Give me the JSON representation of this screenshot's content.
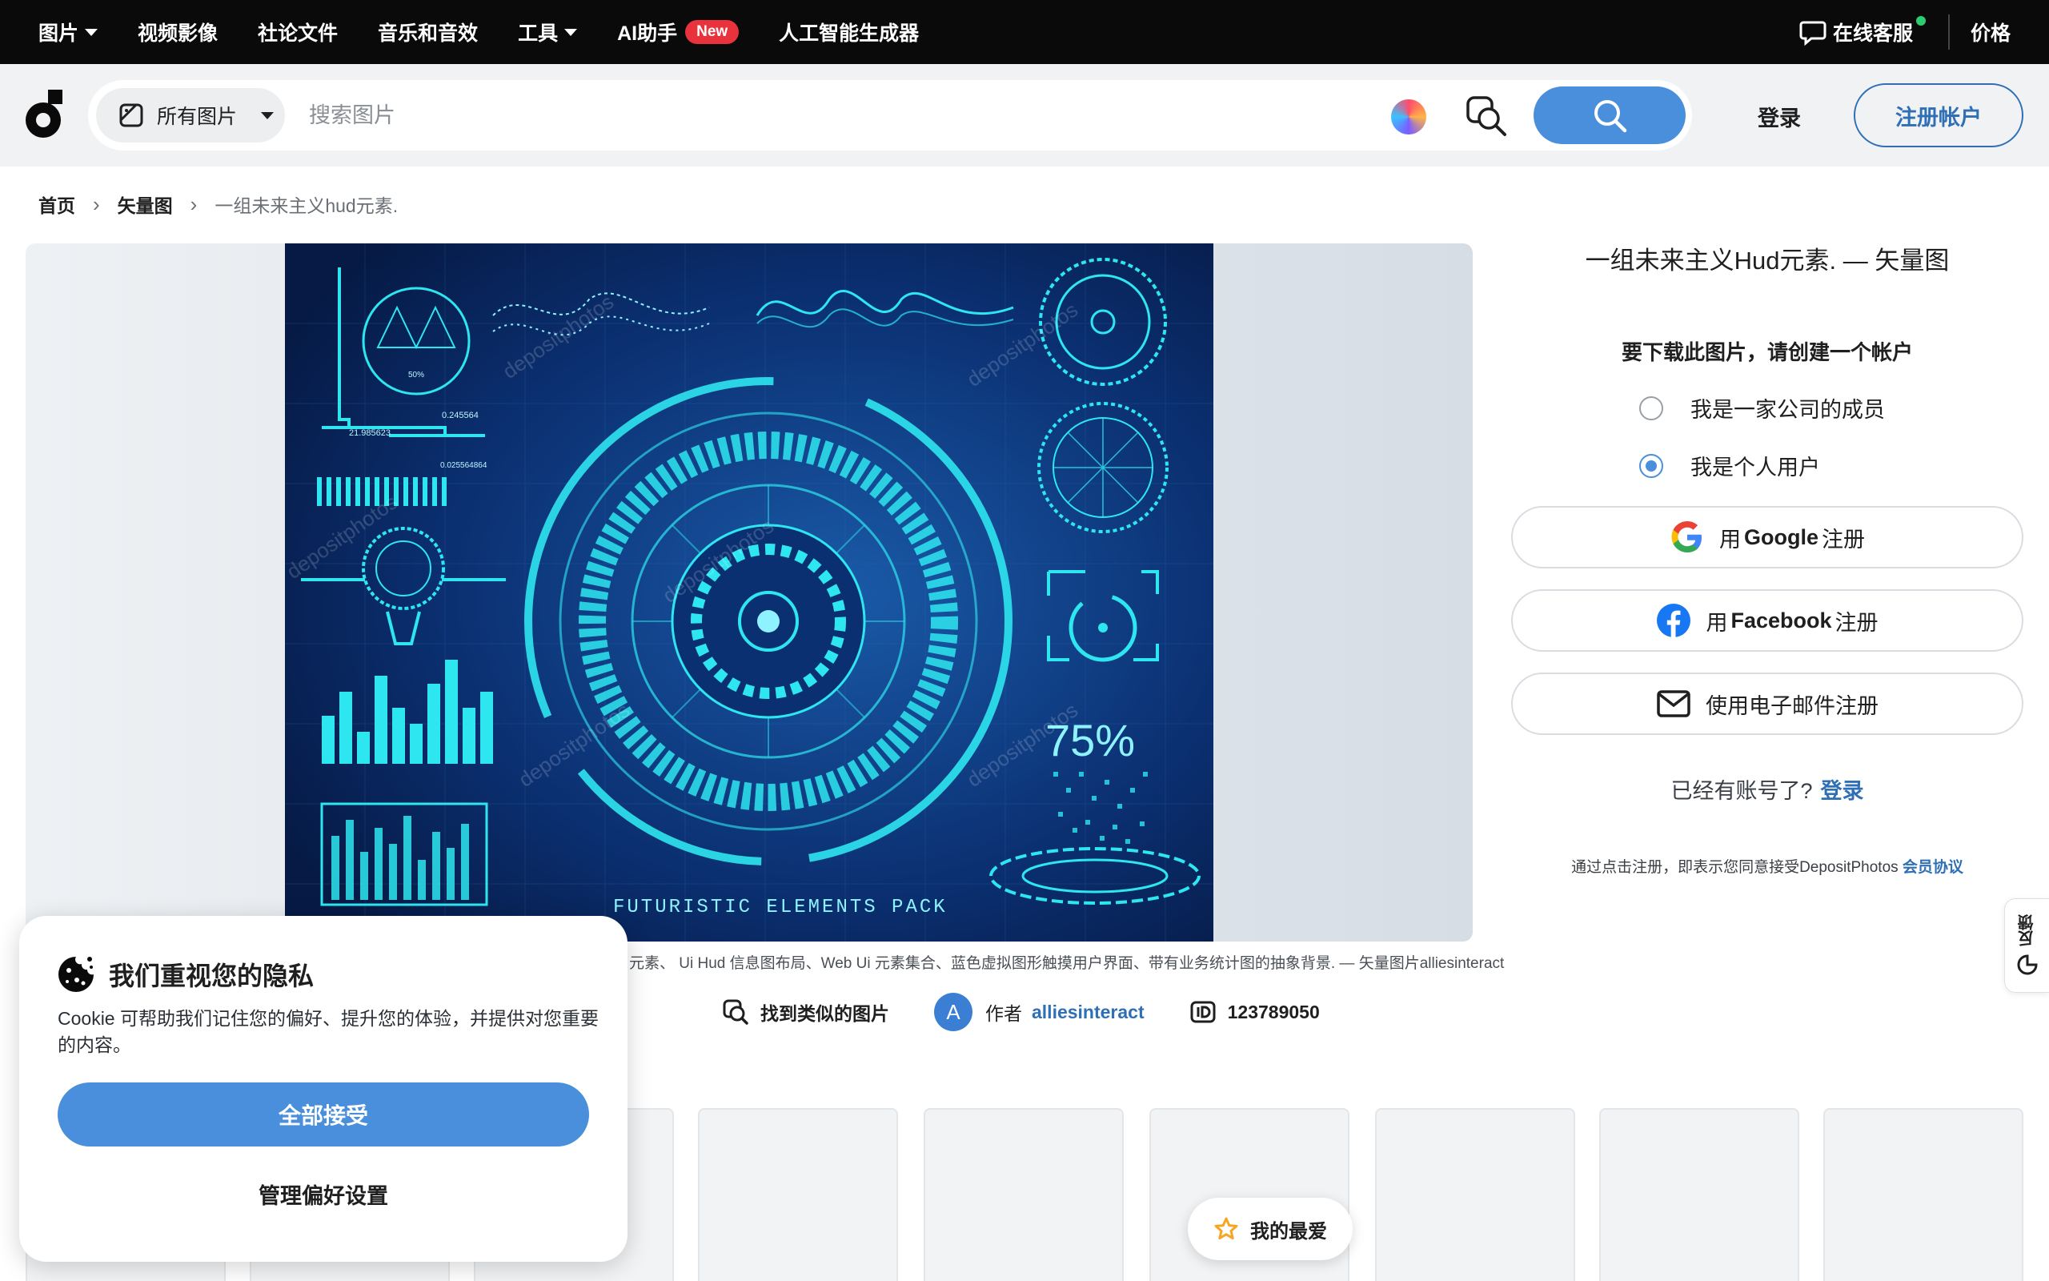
{
  "topnav": {
    "items": [
      {
        "label": "图片",
        "dropdown": true
      },
      {
        "label": "视频影像",
        "dropdown": false
      },
      {
        "label": "社论文件",
        "dropdown": false
      },
      {
        "label": "音乐和音效",
        "dropdown": false
      },
      {
        "label": "工具",
        "dropdown": true
      },
      {
        "label": "AI助手",
        "badge": "New"
      },
      {
        "label": "人工智能生成器",
        "dropdown": false
      }
    ],
    "support_label": "在线客服",
    "pricing_label": "价格"
  },
  "header": {
    "category_label": "所有图片",
    "search_placeholder": "搜索图片",
    "login_label": "登录",
    "signup_label": "注册帐户"
  },
  "breadcrumb": {
    "home": "首页",
    "section": "矢量图",
    "current": "一组未来主义hud元素."
  },
  "preview": {
    "hud_percent_label": "75%",
    "hud_pack_label": "FUTURISTIC ELEMENTS PACK",
    "watermark": "depositphotos",
    "readout_1": "0.245564",
    "readout_2": "21.985623",
    "readout_3": "0.025564864",
    "readout_4": "50%"
  },
  "details": {
    "caption": "元素、 Ui Hud 信息图布局、Web Ui 元素集合、蓝色虚拟图形触摸用户界面、带有业务统计图的抽象背景. — 矢量图片alliesinteract",
    "find_similar": "找到类似的图片",
    "avatar_letter": "A",
    "author_prefix": "作者",
    "author_name": "alliesinteract",
    "image_id": "123789050"
  },
  "panel": {
    "title": "一组未来主义Hud元素. — 矢量图",
    "subtitle": "要下载此图片，请创建一个帐户",
    "radio_company": "我是一家公司的成员",
    "radio_personal": "我是个人用户",
    "google_prefix": "用",
    "google_brand": "Google",
    "google_suffix": "注册",
    "facebook_prefix": "用",
    "facebook_brand": "Facebook",
    "facebook_suffix": "注册",
    "email_label": "使用电子邮件注册",
    "already_text": "已经有账号了?",
    "already_login": "登录",
    "terms_text": "通过点击注册，即表示您同意接受DepositPhotos",
    "terms_link": "会员协议"
  },
  "feedback_label": "反馈",
  "favorites_label": "我的最爱",
  "cookie": {
    "title": "我们重视您的隐私",
    "text": "Cookie 可帮助我们记住您的偏好、提升您的体验，并提供对您重要的内容。",
    "accept": "全部接受",
    "manage": "管理偏好设置"
  },
  "colors": {
    "accent": "#4a8fdc",
    "link": "#2f6fb5",
    "topbar": "#0a0a0a",
    "header_bg": "#f1f2f3",
    "badge": "#e8323c",
    "hud_bg": "#08245a",
    "hud_glow": "#2ee6f0"
  }
}
